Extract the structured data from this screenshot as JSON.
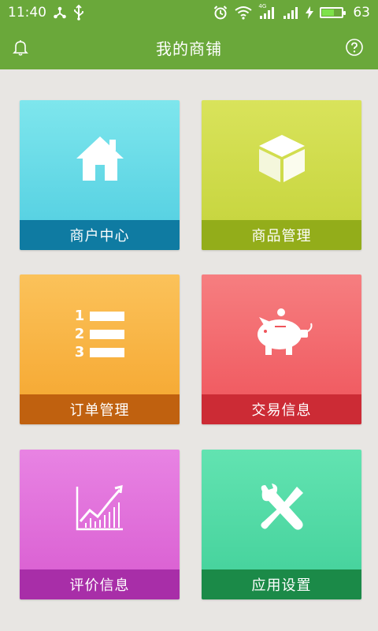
{
  "status_bar": {
    "time": "11:40",
    "battery_level": "63",
    "signal_label": "4G"
  },
  "app_bar": {
    "title": "我的商铺"
  },
  "tiles": [
    {
      "label": "商户中心",
      "icon": "house-icon"
    },
    {
      "label": "商品管理",
      "icon": "cube-icon"
    },
    {
      "label": "订单管理",
      "icon": "numbered-list-icon",
      "numbers": [
        "1",
        "2",
        "3"
      ]
    },
    {
      "label": "交易信息",
      "icon": "piggy-bank-icon"
    },
    {
      "label": "评价信息",
      "icon": "chart-icon"
    },
    {
      "label": "应用设置",
      "icon": "tools-icon"
    }
  ],
  "colors": {
    "header": "#6aa83a",
    "background": "#e8e6e3"
  }
}
